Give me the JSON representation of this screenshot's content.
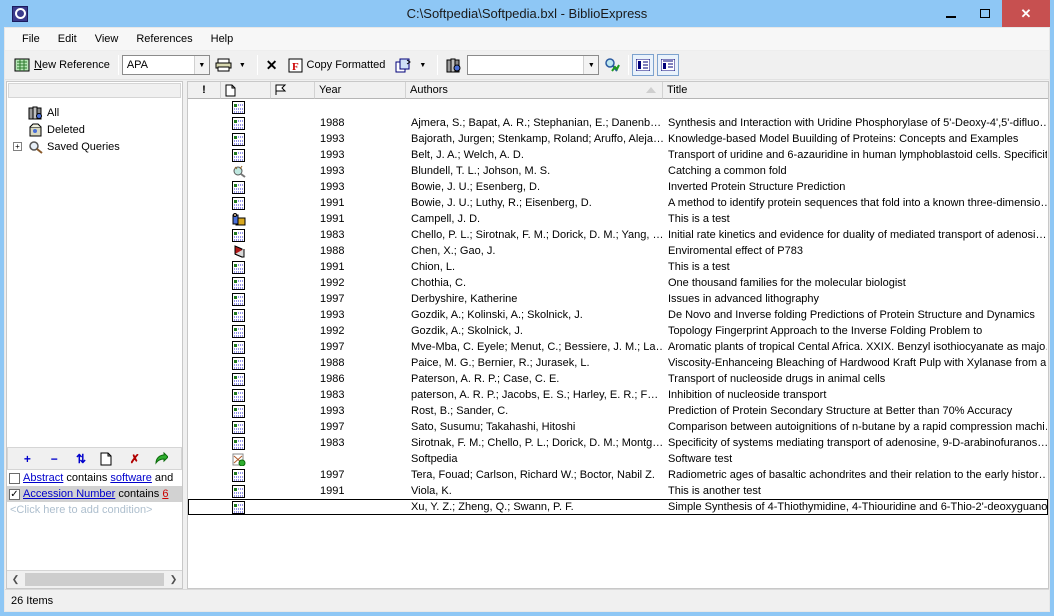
{
  "window": {
    "title": "C:\\Softpedia\\Softpedia.bxl - BiblioExpress",
    "controls": {
      "minimize": "minimize-button",
      "maximize": "maximize-button",
      "close": "✕"
    }
  },
  "menu": {
    "items": [
      "File",
      "Edit",
      "View",
      "References",
      "Help"
    ]
  },
  "toolbar": {
    "new_reference_label": "New Reference",
    "style_combo_value": "APA",
    "copy_formatted_label": "Copy Formatted",
    "search_combo_value": "",
    "icons": [
      "new-reference-icon",
      "print-icon",
      "delete-x-icon",
      "copy-formatted-icon",
      "copy-reference-icon",
      "references-db-icon",
      "run-search-icon",
      "view-list-icon",
      "view-details-icon"
    ]
  },
  "sidebar": {
    "tree": [
      {
        "label": "All",
        "icon": "references-db-icon",
        "expandable": false
      },
      {
        "label": "Deleted",
        "icon": "deleted-box-icon",
        "expandable": false
      },
      {
        "label": "Saved Queries",
        "icon": "saved-queries-icon",
        "expandable": true
      }
    ],
    "condition_toolbar": [
      "add-condition-icon",
      "remove-condition-icon",
      "refresh-conditions-icon",
      "new-query-icon",
      "delete-query-icon",
      "run-query-icon"
    ],
    "conditions": [
      {
        "checked": false,
        "field": "Abstract",
        "op": "contains",
        "value": "software",
        "suffix": "and",
        "selected": false
      },
      {
        "checked": true,
        "field": "Accession Number",
        "op": "contains",
        "value": "6",
        "suffix": "",
        "selected": true
      }
    ],
    "add_condition_prompt": "<Click here to add condition>"
  },
  "table": {
    "columns": [
      {
        "key": "status",
        "label": "!",
        "icon": "urgent-icon"
      },
      {
        "key": "attach",
        "label": "",
        "icon": "attachment-icon"
      },
      {
        "key": "flag",
        "label": "",
        "icon": "flag-icon"
      },
      {
        "key": "year",
        "label": "Year"
      },
      {
        "key": "authors",
        "label": "Authors",
        "sort": "asc"
      },
      {
        "key": "title",
        "label": "Title"
      }
    ],
    "rows": [
      {
        "icon": "reference-card-icon",
        "year": "",
        "authors": "",
        "title": ""
      },
      {
        "icon": "reference-card-icon",
        "year": "1988",
        "authors": "Ajmera, S.; Bapat, A. R.; Stephanian, E.; Danenb…",
        "title": "Synthesis and Interaction with Uridine Phosphorylase of 5'-Deoxy-4',5'-difluo…"
      },
      {
        "icon": "reference-card-icon",
        "year": "1993",
        "authors": "Bajorath, Jurgen; Stenkamp, Roland; Aruffo, Aleja…",
        "title": "Knowledge-based Model Buuilding of Proteins: Concepts and Examples"
      },
      {
        "icon": "reference-card-icon",
        "year": "1993",
        "authors": "Belt, J. A.; Welch, A. D.",
        "title": "Transport of uridine and 6-azauridine in human lymphoblastoid cells. Specificit…"
      },
      {
        "icon": "query-result-icon",
        "year": "1993",
        "authors": "Blundell, T. L.; Johson, M. S.",
        "title": "Catching a common fold"
      },
      {
        "icon": "reference-card-icon",
        "year": "1993",
        "authors": "Bowie, J. U.; Esenberg, D.",
        "title": "Inverted Protein Structure Prediction"
      },
      {
        "icon": "reference-card-icon",
        "year": "1991",
        "authors": "Bowie, J. U.; Luthy, R.; Eisenberg, D.",
        "title": "A method to identify protein sequences that fold into a known three-dimensio…"
      },
      {
        "icon": "chest-icon",
        "year": "1991",
        "authors": "Campell, J. D.",
        "title": "This is a test"
      },
      {
        "icon": "reference-card-icon",
        "year": "1983",
        "authors": "Chello, P. L.; Sirotnak, F. M.; Dorick, D. M.; Yang, …",
        "title": "Initial rate kinetics and evidence for duality of mediated transport of adenosi…"
      },
      {
        "icon": "book-icon",
        "year": "1988",
        "authors": "Chen, X.; Gao, J.",
        "title": "Enviromental effect of P783"
      },
      {
        "icon": "reference-card-icon",
        "year": "1991",
        "authors": "Chion, L.",
        "title": "This is a test"
      },
      {
        "icon": "reference-card-icon",
        "year": "1992",
        "authors": "Chothia, C.",
        "title": "One thousand families for the molecular biologist"
      },
      {
        "icon": "reference-card-icon",
        "year": "1997",
        "authors": "Derbyshire, Katherine",
        "title": "Issues in advanced lithography"
      },
      {
        "icon": "reference-card-icon",
        "year": "1993",
        "authors": "Gozdik, A.; Kolinski, A.; Skolnick, J.",
        "title": "De Novo and Inverse folding Predictions of Protein Structure and Dynamics"
      },
      {
        "icon": "reference-card-icon",
        "year": "1992",
        "authors": "Gozdik, A.; Skolnick, J.",
        "title": "Topology Fingerprint Approach to the Inverse Folding Problem to"
      },
      {
        "icon": "reference-card-icon",
        "year": "1997",
        "authors": "Mve-Mba, C. Eyele; Menut, C.; Bessiere, J. M.; La…",
        "title": "Aromatic plants of tropical Cental Africa. XXIX. Benzyl isothiocyanate as majo…"
      },
      {
        "icon": "reference-card-icon",
        "year": "1988",
        "authors": "Paice, M. G.; Bernier, R.; Jurasek, L.",
        "title": "Viscosity-Enhanceing Bleaching of Hardwood Kraft Pulp with Xylanase from a …"
      },
      {
        "icon": "reference-card-icon",
        "year": "1986",
        "authors": "Paterson, A. R. P.; Case, C. E.",
        "title": "Transport of nucleoside drugs in animal cells"
      },
      {
        "icon": "reference-card-icon",
        "year": "1983",
        "authors": "paterson, A. R. P.; Jacobs, E. S.; Harley, E. R.; F…",
        "title": "Inhibition of nucleoside transport"
      },
      {
        "icon": "reference-card-icon",
        "year": "1993",
        "authors": "Rost, B.; Sander, C.",
        "title": "Prediction of Protein Secondary Structure at Better than 70% Accuracy"
      },
      {
        "icon": "reference-card-icon",
        "year": "1997",
        "authors": "Sato, Susumu; Takahashi, Hitoshi",
        "title": "Comparison between autoignitions of n-butane by a rapid compression machi…"
      },
      {
        "icon": "reference-card-icon",
        "year": "1983",
        "authors": "Sirotnak, F. M.; Chello, P. L.; Dorick, D. M.; Montg…",
        "title": "Specificity of systems mediating transport of adenosine, 9-D-arabinofuranos…"
      },
      {
        "icon": "software-note-icon",
        "year": "",
        "authors": "Softpedia",
        "title": "Software test"
      },
      {
        "icon": "reference-card-icon",
        "year": "1997",
        "authors": "Tera, Fouad; Carlson, Richard W.; Boctor, Nabil Z.",
        "title": "Radiometric ages of basaltic achondrites and their relation to the early histor…"
      },
      {
        "icon": "reference-card-icon",
        "year": "1991",
        "authors": "Viola, K.",
        "title": "This is another test"
      },
      {
        "icon": "reference-card-icon",
        "year": "",
        "authors": "Xu, Y. Z.; Zheng, Q.; Swann, P. F.",
        "title": "Simple Synthesis of 4-Thiothymidine, 4-Thiouridine and 6-Thio-2'-deoxyguano…",
        "selected": true
      }
    ]
  },
  "statusbar": {
    "items_count": "26 Items"
  },
  "colors": {
    "titlebar": "#8ec7f5",
    "close_button": "#c75050",
    "link": "#0000cc",
    "link_value_red": "#cc0000",
    "selection_gray": "#d2d2d2"
  }
}
